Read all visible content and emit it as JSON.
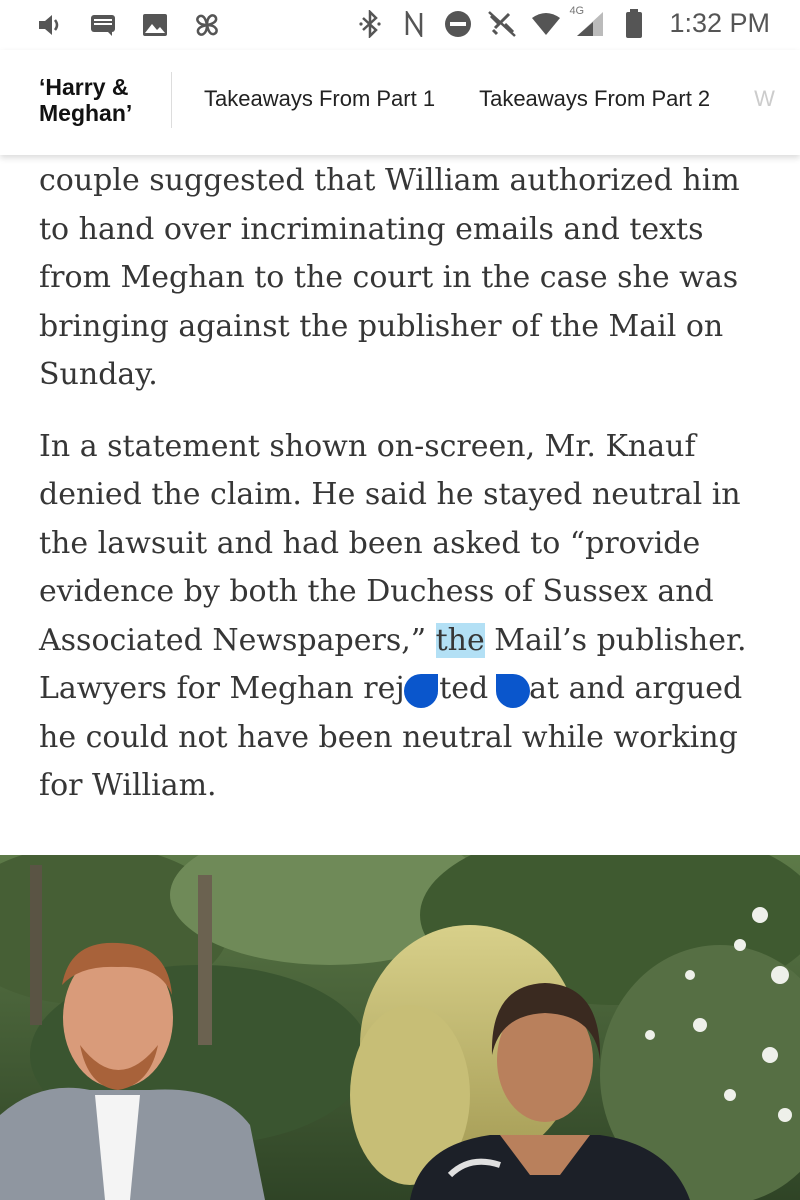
{
  "status_bar": {
    "time": "1:32 PM",
    "network_label": "4G",
    "left_icons": [
      "volume-icon",
      "message-icon",
      "image-icon",
      "pinwheel-icon"
    ],
    "right_icons": [
      "bluetooth-icon",
      "nfc-icon",
      "do-not-disturb-icon",
      "no-tools-icon",
      "wifi-icon",
      "signal-icon",
      "battery-icon"
    ]
  },
  "section_nav": {
    "title_line1": "‘Harry &",
    "title_line2": "Meghan’",
    "tabs": [
      {
        "label": "Takeaways From Part 1"
      },
      {
        "label": "Takeaways From Part 2"
      },
      {
        "label": "W"
      }
    ]
  },
  "article": {
    "para1": "couple suggested that William authorized him to hand over incriminating emails and texts from Meghan to the court in the case she was bringing against the publisher of the Mail on Sunday.",
    "para2_before": "In a statement shown on-screen, Mr. Knauf denied the claim. He said he stayed neutral in the lawsuit and had been asked to “provide evidence by both the Duchess of Sussex and Associated Newspapers,” ",
    "para2_selected": "the",
    "para2_after": " Mail’s publisher. Lawyers for Meghan rejected that and argued he could not have been neutral while working for William."
  },
  "colors": {
    "selection_highlight": "#b3e0f5",
    "selection_handle": "#0a56cc",
    "text": "#363636"
  }
}
